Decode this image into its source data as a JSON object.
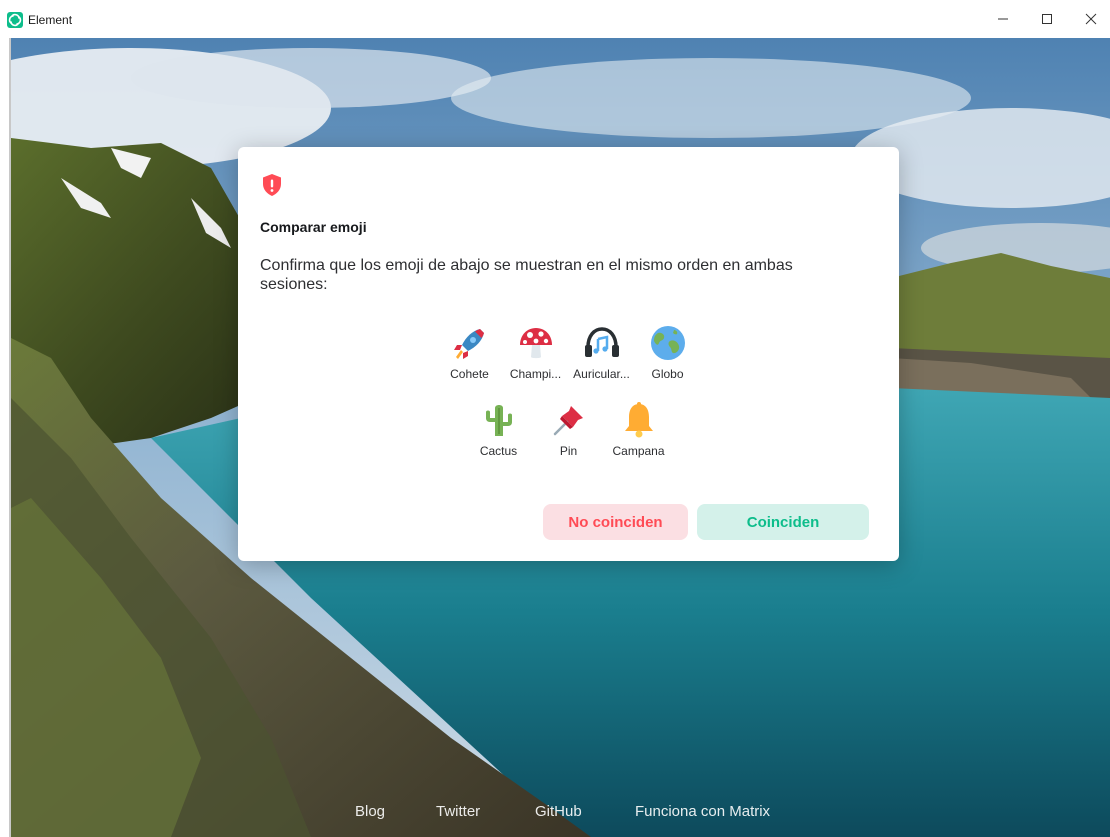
{
  "window": {
    "title": "Element",
    "logo_icon": "element-logo-icon",
    "controls": [
      "minimize-icon",
      "maximize-icon",
      "close-icon"
    ]
  },
  "dialog": {
    "icon": "shield-warning-icon",
    "title": "Comparar emoji",
    "description": "Confirma que los emoji de abajo se muestran en el mismo orden en ambas sesiones:",
    "emojis_row1": [
      {
        "icon": "rocket-icon",
        "label": "Cohete"
      },
      {
        "icon": "mushroom-icon",
        "label": "Champi..."
      },
      {
        "icon": "headphones-icon",
        "label": "Auricular..."
      },
      {
        "icon": "globe-icon",
        "label": "Globo"
      }
    ],
    "emojis_row2": [
      {
        "icon": "cactus-icon",
        "label": "Cactus"
      },
      {
        "icon": "pin-icon",
        "label": "Pin"
      },
      {
        "icon": "bell-icon",
        "label": "Campana"
      }
    ],
    "buttons": {
      "no_match": "No coinciden",
      "match": "Coinciden"
    }
  },
  "footer": {
    "links": [
      "Blog",
      "Twitter",
      "GitHub",
      "Funciona con Matrix"
    ]
  },
  "colors": {
    "accent": "#0dbd8b",
    "danger": "#ff4b55",
    "danger_bg": "#fbdfe3",
    "accent_bg": "#d4f1ea"
  }
}
